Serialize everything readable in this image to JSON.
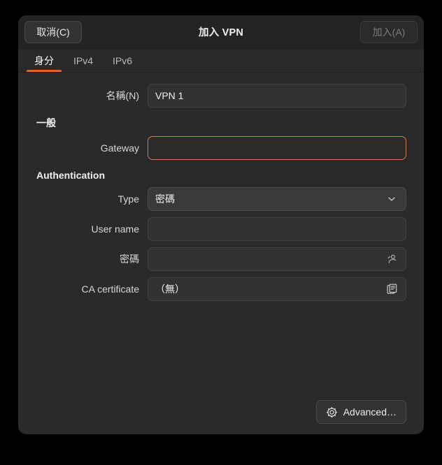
{
  "window": {
    "title": "加入 VPN",
    "cancel_label": "取消(C)",
    "add_label": "加入(A)",
    "add_disabled": true,
    "accent_color": "#e8602c",
    "error_border_color": "#cd7c57",
    "background_color": "#2a2a2a",
    "header_color": "#242424"
  },
  "tabs": [
    {
      "label": "身分",
      "active": true
    },
    {
      "label": "IPv4",
      "active": false
    },
    {
      "label": "IPv6",
      "active": false
    }
  ],
  "form": {
    "name": {
      "label": "名稱(N)",
      "value": "VPN 1",
      "placeholder": ""
    },
    "general": {
      "title": "一般",
      "gateway": {
        "label": "Gateway",
        "value": "",
        "placeholder": "",
        "error": true
      }
    },
    "authentication": {
      "title": "Authentication",
      "type": {
        "label": "Type",
        "value": "密碼",
        "icon": "chevron-down-icon"
      },
      "user_name": {
        "label": "User name",
        "value": "",
        "placeholder": ""
      },
      "password": {
        "label": "密碼",
        "value": "",
        "placeholder": "",
        "icon": "person-icon"
      },
      "ca_certificate": {
        "label": "CA certificate",
        "value": "（無）",
        "icon": "document-open-icon"
      }
    }
  },
  "footer": {
    "advanced_label": "Advanced…",
    "advanced_icon": "gear-icon"
  }
}
